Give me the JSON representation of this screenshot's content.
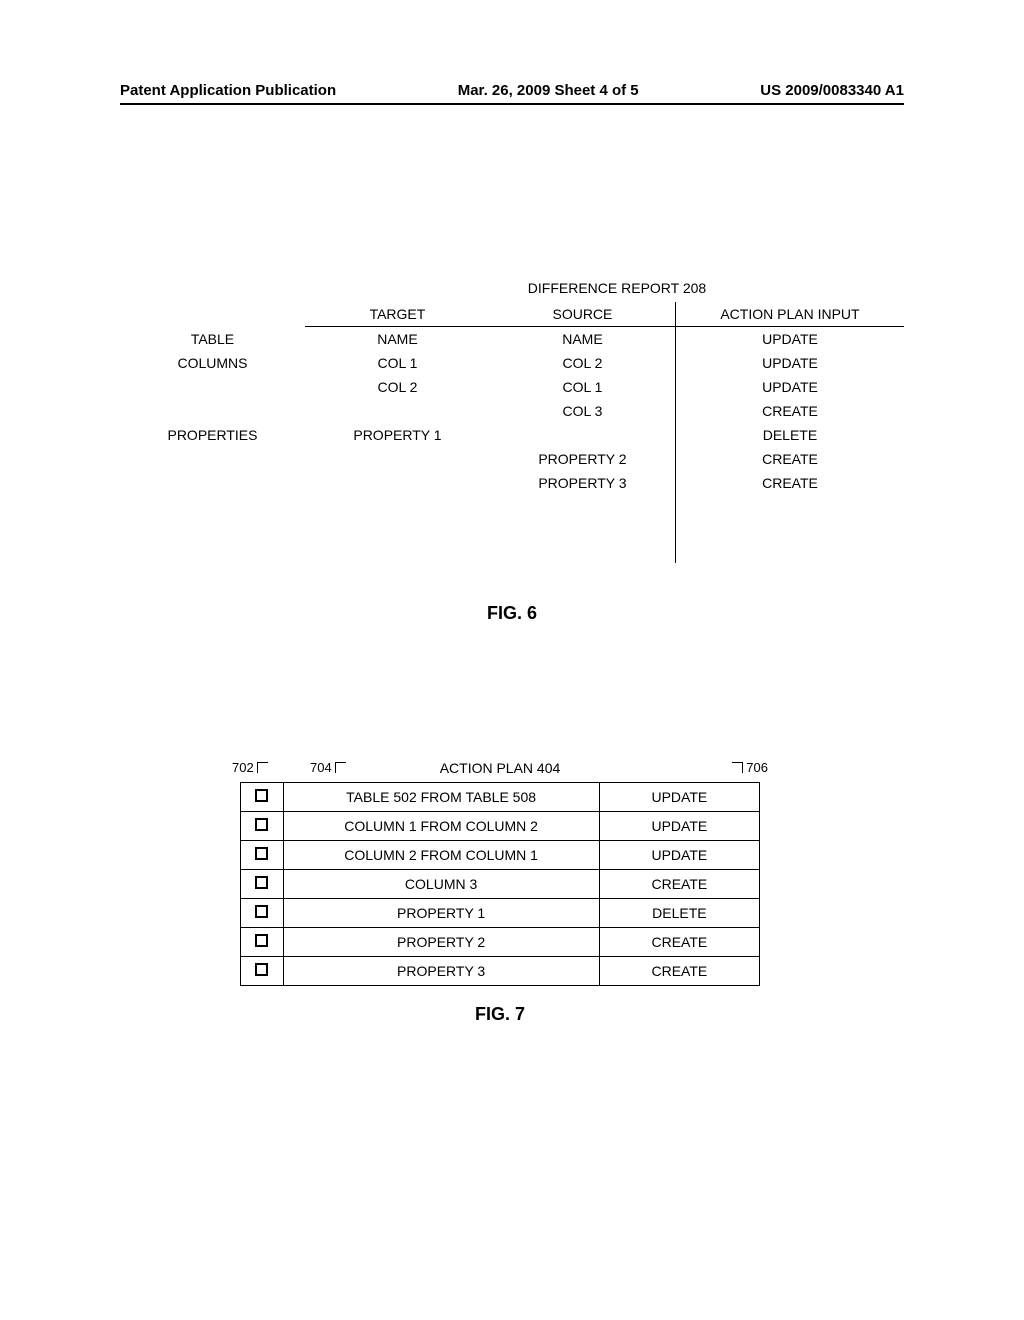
{
  "header": {
    "left": "Patent Application Publication",
    "center": "Mar. 26, 2009  Sheet 4 of 5",
    "right": "US 2009/0083340 A1"
  },
  "fig6": {
    "title": "DIFFERENCE REPORT 208",
    "columns": {
      "target": "TARGET",
      "source": "SOURCE",
      "action": "ACTION PLAN INPUT"
    },
    "rows": [
      {
        "label": "TABLE",
        "target": "NAME",
        "source": "NAME",
        "action": "UPDATE"
      },
      {
        "label": "COLUMNS",
        "target": "COL 1",
        "source": "COL 2",
        "action": "UPDATE"
      },
      {
        "label": "",
        "target": "COL 2",
        "source": "COL 1",
        "action": "UPDATE"
      },
      {
        "label": "",
        "target": "",
        "source": "COL 3",
        "action": "CREATE"
      },
      {
        "label": "PROPERTIES",
        "target": "PROPERTY 1",
        "source": "",
        "action": "DELETE"
      },
      {
        "label": "",
        "target": "",
        "source": "PROPERTY 2",
        "action": "CREATE"
      },
      {
        "label": "",
        "target": "",
        "source": "PROPERTY 3",
        "action": "CREATE"
      }
    ],
    "caption": "FIG. 6"
  },
  "fig7": {
    "title": "ACTION PLAN 404",
    "labels": {
      "l702": "702",
      "l704": "704",
      "l706": "706"
    },
    "rows": [
      {
        "desc": "TABLE 502 FROM TABLE 508",
        "action": "UPDATE"
      },
      {
        "desc": "COLUMN 1 FROM COLUMN 2",
        "action": "UPDATE"
      },
      {
        "desc": "COLUMN 2 FROM COLUMN 1",
        "action": "UPDATE"
      },
      {
        "desc": "COLUMN 3",
        "action": "CREATE"
      },
      {
        "desc": "PROPERTY 1",
        "action": "DELETE"
      },
      {
        "desc": "PROPERTY 2",
        "action": "CREATE"
      },
      {
        "desc": "PROPERTY 3",
        "action": "CREATE"
      }
    ],
    "caption": "FIG. 7"
  },
  "chart_data": [
    {
      "type": "table",
      "title": "DIFFERENCE REPORT 208",
      "columns": [
        "",
        "TARGET",
        "SOURCE",
        "ACTION PLAN INPUT"
      ],
      "rows": [
        [
          "TABLE",
          "NAME",
          "NAME",
          "UPDATE"
        ],
        [
          "COLUMNS",
          "COL 1",
          "COL 2",
          "UPDATE"
        ],
        [
          "",
          "COL 2",
          "COL 1",
          "UPDATE"
        ],
        [
          "",
          "",
          "COL 3",
          "CREATE"
        ],
        [
          "PROPERTIES",
          "PROPERTY 1",
          "",
          "DELETE"
        ],
        [
          "",
          "",
          "PROPERTY 2",
          "CREATE"
        ],
        [
          "",
          "",
          "PROPERTY 3",
          "CREATE"
        ]
      ]
    },
    {
      "type": "table",
      "title": "ACTION PLAN 404",
      "columns": [
        "checkbox",
        "description",
        "action"
      ],
      "rows": [
        [
          false,
          "TABLE 502 FROM TABLE 508",
          "UPDATE"
        ],
        [
          false,
          "COLUMN 1 FROM COLUMN 2",
          "UPDATE"
        ],
        [
          false,
          "COLUMN 2 FROM COLUMN 1",
          "UPDATE"
        ],
        [
          false,
          "COLUMN 3",
          "CREATE"
        ],
        [
          false,
          "PROPERTY 1",
          "DELETE"
        ],
        [
          false,
          "PROPERTY 2",
          "CREATE"
        ],
        [
          false,
          "PROPERTY 3",
          "CREATE"
        ]
      ]
    }
  ]
}
